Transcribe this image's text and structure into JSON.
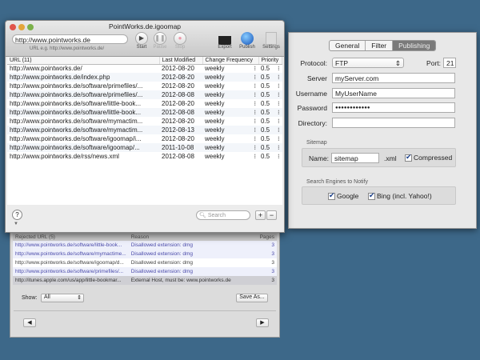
{
  "window": {
    "title": "PointWorks.de.igoomap"
  },
  "toolbar": {
    "url_value": "http://www.pointworks.de",
    "url_hint": "URL e.g. http://www.pointworks.de/",
    "start": "Start",
    "pause": "Pause",
    "stop": "Stop",
    "export": "Export",
    "publish": "Publish",
    "settings": "Settings"
  },
  "table": {
    "headers": [
      "URL (11)",
      "Last Modified",
      "Change Frequency",
      "Priority"
    ],
    "rows": [
      [
        "http://www.pointworks.de/",
        "2012-08-20",
        "weekly",
        "0.5"
      ],
      [
        "http://www.pointworks.de/index.php",
        "2012-08-20",
        "weekly",
        "0.5"
      ],
      [
        "http://www.pointworks.de/software/primefiles/...",
        "2012-08-20",
        "weekly",
        "0.5"
      ],
      [
        "http://www.pointworks.de/software/primefiles/...",
        "2012-08-08",
        "weekly",
        "0.5"
      ],
      [
        "http://www.pointworks.de/software/little-book...",
        "2012-08-20",
        "weekly",
        "0.5"
      ],
      [
        "http://www.pointworks.de/software/little-book...",
        "2012-08-08",
        "weekly",
        "0.5"
      ],
      [
        "http://www.pointworks.de/software/mymactim...",
        "2012-08-20",
        "weekly",
        "0.5"
      ],
      [
        "http://www.pointworks.de/software/mymactim...",
        "2012-08-13",
        "weekly",
        "0.5"
      ],
      [
        "http://www.pointworks.de/software/igoomap/i...",
        "2012-08-20",
        "weekly",
        "0.5"
      ],
      [
        "http://www.pointworks.de/software/igoomap/...",
        "2011-10-08",
        "weekly",
        "0.5"
      ],
      [
        "http://www.pointworks.de/rss/news.xml",
        "2012-08-08",
        "weekly",
        "0.5"
      ]
    ]
  },
  "bottom": {
    "help": "?",
    "search_placeholder": "Search",
    "add": "+",
    "remove": "−"
  },
  "rejected": {
    "headers": [
      "Rejected URL (5)",
      "Reason",
      "Pages"
    ],
    "rows": [
      [
        "http://www.pointworks.de/software/little-book...",
        "Disallowed extension: dmg",
        "3"
      ],
      [
        "http://www.pointworks.de/software/mymactime...",
        "Disallowed extension: dmg",
        "3"
      ],
      [
        "http://www.pointworks.de/software/igoomap/d...",
        "Disallowed extension: dmg",
        "3"
      ],
      [
        "http://www.pointworks.de/software/primefiles/...",
        "Disallowed extension: dmg",
        "3"
      ],
      [
        "http://itunes.apple.com/us/app/little-bookmar...",
        "External Host, must be: www.pointworks.de",
        "3"
      ]
    ],
    "show_label": "Show:",
    "show_value": "All",
    "save_as": "Save As...",
    "prev": "◀",
    "next": "▶"
  },
  "settings": {
    "tabs": [
      "General",
      "Filter",
      "Publishing"
    ],
    "selected_tab": "Publishing",
    "protocol_label": "Protocol:",
    "protocol": "FTP",
    "port_label": "Port:",
    "port": "21",
    "server_label": "Server",
    "server": "myServer.com",
    "username_label": "Username",
    "username": "MyUserName",
    "password_label": "Password",
    "password": "●●●●●●●●●●●●",
    "directory_label": "Directory:",
    "directory": "",
    "sitemap_label": "Sitemap",
    "name_label": "Name:",
    "name": "sitemap",
    "ext": ".xml",
    "compressed": "Compressed",
    "engines_label": "Search Engines to Notify",
    "google": "Google",
    "bing": "Bing (incl. Yahoo!)"
  }
}
